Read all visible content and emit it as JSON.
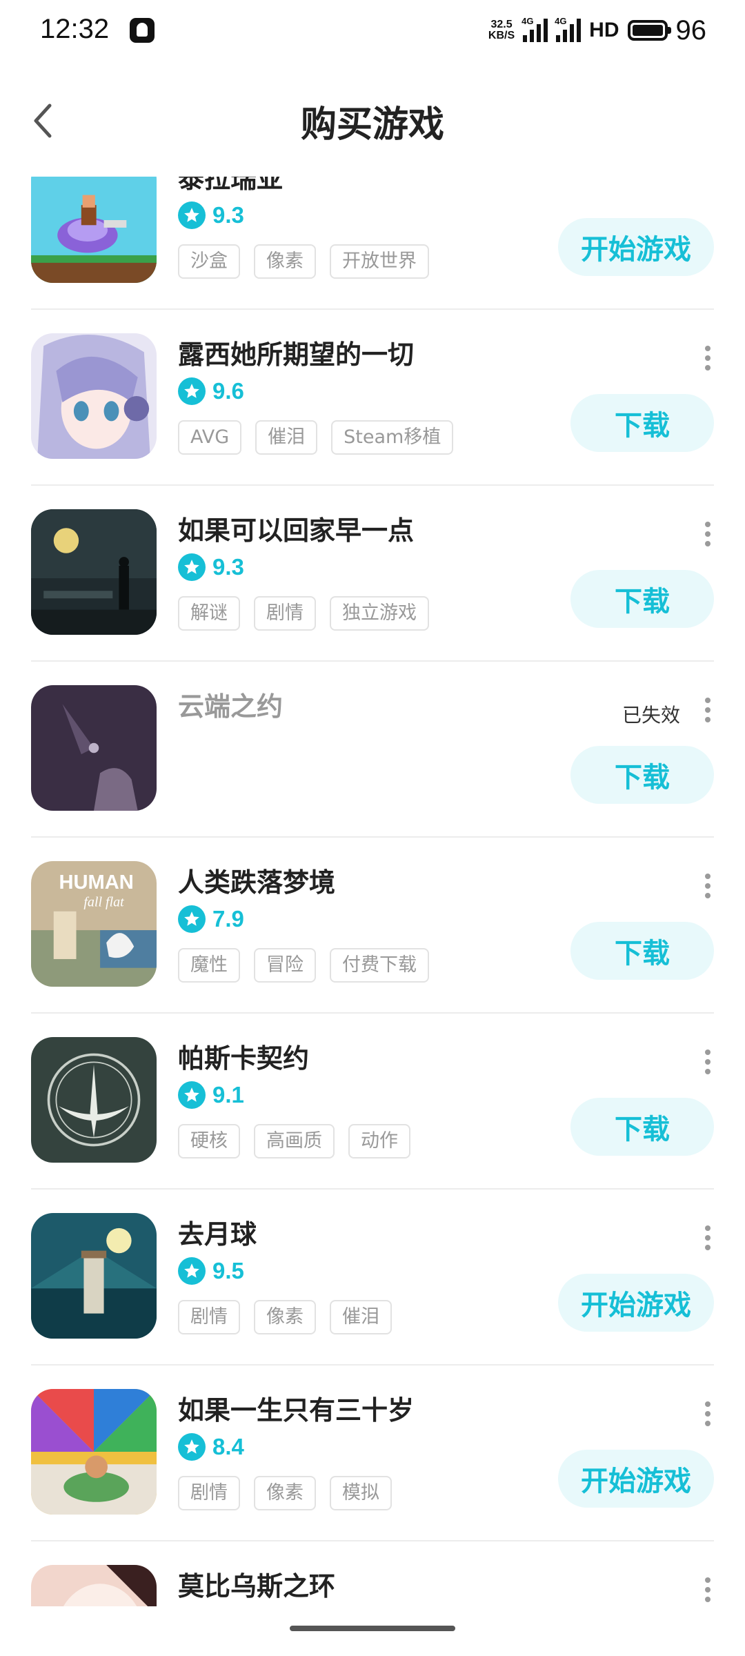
{
  "status_bar": {
    "time": "12:32",
    "net_speed_value": "32.5",
    "net_speed_unit": "KB/S",
    "signal_label_1": "4G",
    "signal_label_2": "4G",
    "hd_label": "HD",
    "battery": "96"
  },
  "header": {
    "title": "购买游戏"
  },
  "games": [
    {
      "name": "泰拉瑞亚",
      "rating": "9.3",
      "tags": [
        "沙盒",
        "像素",
        "开放世界"
      ],
      "action": "开始游戏",
      "action_type": "play",
      "status": "",
      "icon": "terraria-thumbnail"
    },
    {
      "name": "露西她所期望的一切",
      "rating": "9.6",
      "tags": [
        "AVG",
        "催泪",
        "Steam移植"
      ],
      "action": "下载",
      "action_type": "download",
      "status": "",
      "icon": "lucy-thumbnail"
    },
    {
      "name": "如果可以回家早一点",
      "rating": "9.3",
      "tags": [
        "解谜",
        "剧情",
        "独立游戏"
      ],
      "action": "下载",
      "action_type": "download",
      "status": "",
      "icon": "home-early-thumbnail"
    },
    {
      "name": "云端之约",
      "rating": "",
      "tags": [],
      "action": "下载",
      "action_type": "download",
      "status": "已失效",
      "icon": "cloud-date-thumbnail"
    },
    {
      "name": "人类跌落梦境",
      "rating": "7.9",
      "tags": [
        "魔性",
        "冒险",
        "付费下载"
      ],
      "action": "下载",
      "action_type": "download",
      "status": "",
      "icon": "human-fall-flat-thumbnail",
      "icon_text_1": "HUMAN",
      "icon_text_2": "fall flat"
    },
    {
      "name": "帕斯卡契约",
      "rating": "9.1",
      "tags": [
        "硬核",
        "高画质",
        "动作"
      ],
      "action": "下载",
      "action_type": "download",
      "status": "",
      "icon": "pascal-thumbnail"
    },
    {
      "name": "去月球",
      "rating": "9.5",
      "tags": [
        "剧情",
        "像素",
        "催泪"
      ],
      "action": "开始游戏",
      "action_type": "play",
      "status": "",
      "icon": "to-the-moon-thumbnail"
    },
    {
      "name": "如果一生只有三十岁",
      "rating": "8.4",
      "tags": [
        "剧情",
        "像素",
        "模拟"
      ],
      "action": "开始游戏",
      "action_type": "play",
      "status": "",
      "icon": "thirty-thumbnail"
    },
    {
      "name": "莫比乌斯之环",
      "rating": "",
      "tags": [],
      "action": "",
      "action_type": "",
      "status": "",
      "icon": "mobius-thumbnail"
    }
  ],
  "colors": {
    "accent": "#16bfd6",
    "button_bg": "#e8f9fb",
    "tag_text": "#999999",
    "title_text": "#222222"
  }
}
